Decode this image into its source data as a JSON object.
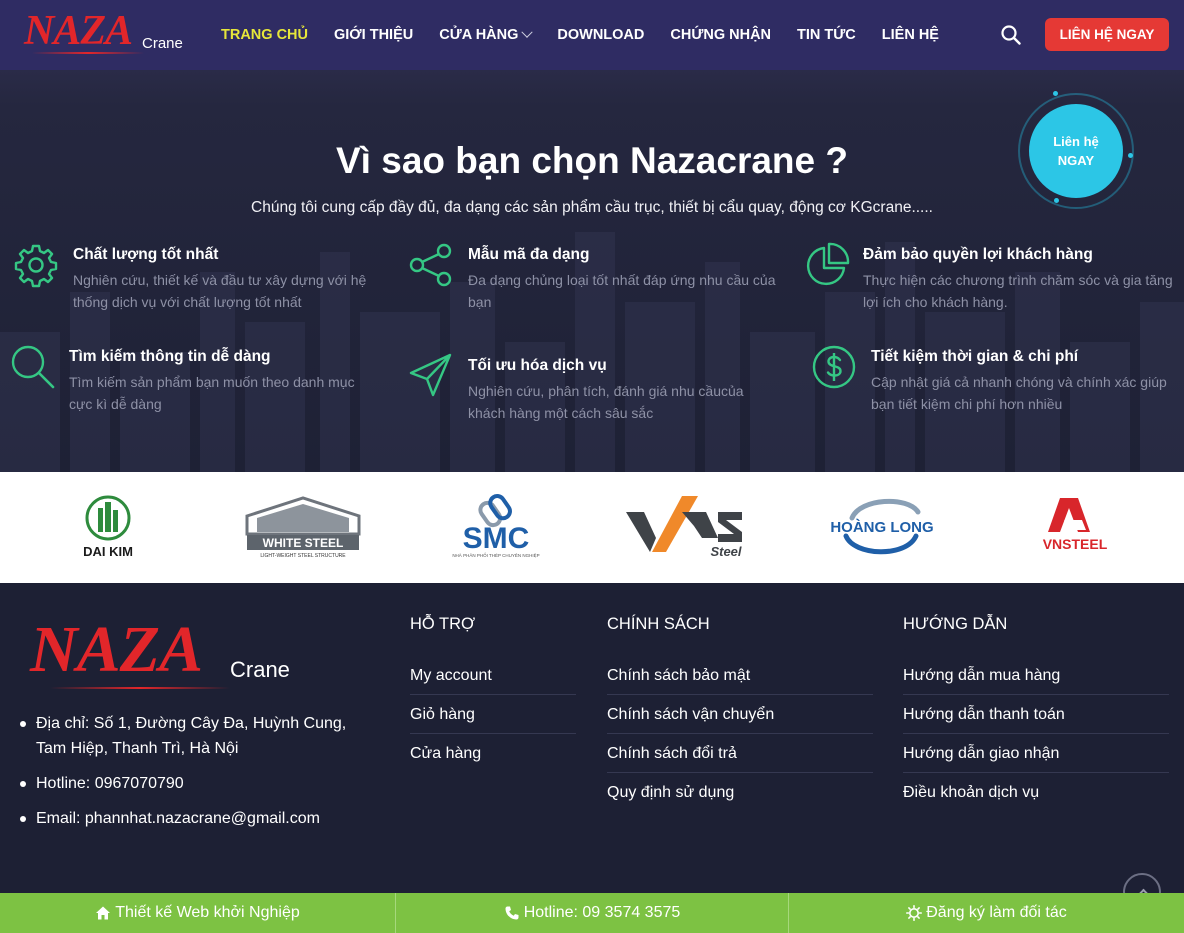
{
  "nav": {
    "logo_text": "NAZA",
    "logo_sub": "Crane",
    "items": [
      {
        "label": "TRANG CHỦ",
        "active": true
      },
      {
        "label": "GIỚI THIỆU"
      },
      {
        "label": "CỬA HÀNG",
        "has_dropdown": true
      },
      {
        "label": "DOWNLOAD"
      },
      {
        "label": "CHỨNG NHẬN"
      },
      {
        "label": "TIN TỨC"
      },
      {
        "label": "LIÊN HỆ"
      }
    ],
    "search_icon": "search-icon",
    "cta_label": "LIÊN HỆ NGAY"
  },
  "hero": {
    "title": "Vì sao bạn chọn Nazacrane ?",
    "subtitle": "Chúng tôi cung cấp đầy đủ, đa dạng các sản phẩm cầu trục, thiết bị cẩu quay, động cơ KGcrane.....",
    "bubble_line1": "Liên hệ",
    "bubble_line2": "NGAY",
    "features": [
      {
        "icon": "gear-icon",
        "title": "Chất lượng tốt nhất",
        "desc": "Nghiên cứu, thiết kế và đầu tư xây dựng với hệ thống dịch vụ với chất lượng tốt nhất"
      },
      {
        "icon": "share-icon",
        "title": "Mẫu mã đa dạng",
        "desc": "Đa dạng chủng loại tốt nhất đáp ứng nhu cầu của bạn"
      },
      {
        "icon": "pie-chart-icon",
        "title": "Đảm bảo quyền lợi khách hàng",
        "desc": "Thực hiện các chương trình chăm sóc và gia tăng lợi ích cho khách hàng."
      },
      {
        "icon": "search-icon",
        "title": "Tìm kiếm thông tin dễ dàng",
        "desc": "Tìm kiếm sản phẩm bạn muốn theo danh mục cực kì dễ dàng"
      },
      {
        "icon": "send-icon",
        "title": "Tối ưu hóa dịch vụ",
        "desc": "Nghiên cứu, phân tích, đánh giá nhu cầucủa khách hàng một cách sâu sắc"
      },
      {
        "icon": "dollar-icon",
        "title": "Tiết kiệm thời gian & chi phí",
        "desc": "Cập nhật giá cả nhanh chóng và chính xác giúp bạn tiết kiệm chi phí hơn nhiều"
      }
    ]
  },
  "partners": {
    "daikim": "DAI KIM",
    "whitesteel": "WHITE STEEL",
    "whitesteel_sub": "LIGHT-WEIGHT STEEL STRUCTURE",
    "smc": "SMC",
    "smc_sub": "NHÀ PHÂN PHỐI THÉP CHUYÊN NGHIỆP",
    "vas": "VAS",
    "vas_sub": "Steel",
    "hoanglong": "HOÀNG LONG",
    "vnsteel": "VNSTEEL"
  },
  "footer": {
    "logo_text": "NAZA",
    "logo_sub": "Crane",
    "contact": [
      "Địa chỉ: Số 1, Đường Cây Đa, Huỳnh Cung, Tam Hiệp, Thanh Trì, Hà Nội",
      "Hotline: 0967070790",
      "Email: phannhat.nazacrane@gmail.com"
    ],
    "support": {
      "heading": "HỖ TRỢ",
      "links": [
        "My account",
        "Giỏ hàng",
        "Cửa hàng"
      ]
    },
    "policy": {
      "heading": "CHÍNH SÁCH",
      "links": [
        "Chính sách bảo mật",
        "Chính sách vận chuyển",
        "Chính sách đổi trả",
        "Quy định sử dụng"
      ]
    },
    "guide": {
      "heading": "HƯỚNG DẪN",
      "links": [
        "Hướng dẫn mua hàng",
        "Hướng dẫn thanh toán",
        "Hướng dẫn giao nhận",
        "Điều khoản dịch vụ"
      ]
    }
  },
  "bottombar": [
    {
      "icon": "home-icon",
      "label": "Thiết kế Web khởi Nghiệp"
    },
    {
      "icon": "phone-icon",
      "label": "Hotline: 09 3574 3575"
    },
    {
      "icon": "sun-icon",
      "label": "Đăng ký làm đối tác"
    }
  ],
  "colors": {
    "nav_bg": "#2f2c63",
    "accent_yellow": "#e6e63a",
    "cta_red": "#e53935",
    "icon_green": "#35c784",
    "bubble_cyan": "#2cc6e6",
    "bottom_green": "#7dc243"
  }
}
